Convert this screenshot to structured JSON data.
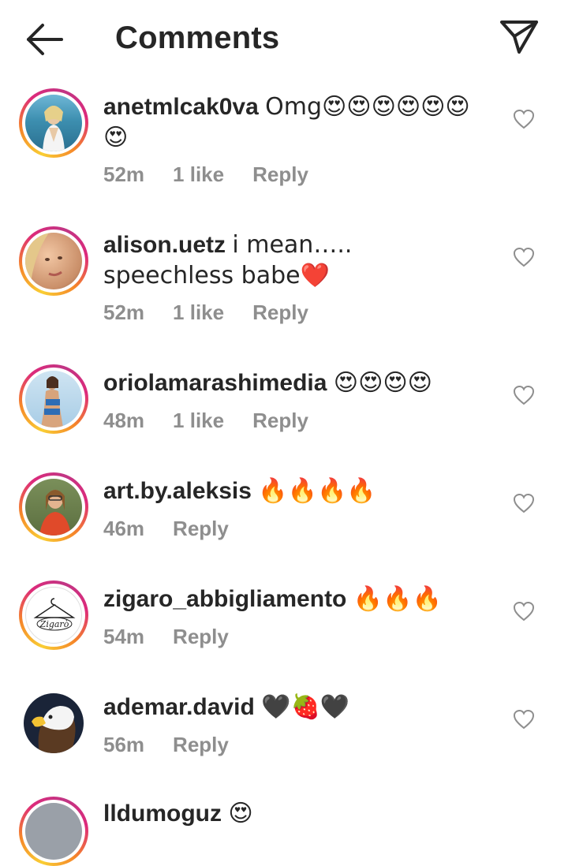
{
  "header": {
    "title": "Comments",
    "back_icon": "arrow-left-icon",
    "send_icon": "paper-plane-icon"
  },
  "colors": {
    "text": "#262626",
    "meta": "#8e8e8e",
    "ring_start": "#f9ce34",
    "ring_mid": "#dd2a7b",
    "ring_end": "#c13584"
  },
  "comments": [
    {
      "username": "anetmlcak0va",
      "text": "Omg😍😍😍😍😍😍😍",
      "time": "52m",
      "likes": "1 like",
      "reply": "Reply"
    },
    {
      "username": "alison.uetz",
      "text": "i mean….. speechless babe❤️",
      "time": "52m",
      "likes": "1 like",
      "reply": "Reply"
    },
    {
      "username": "oriolamarashimedia",
      "text": "😍😍😍😍",
      "time": "48m",
      "likes": "1 like",
      "reply": "Reply"
    },
    {
      "username": "art.by.aleksis",
      "text": "🔥🔥🔥🔥",
      "time": "46m",
      "reply": "Reply"
    },
    {
      "username": "zigaro_abbigliamento",
      "text": "🔥🔥🔥",
      "time": "54m",
      "reply": "Reply"
    },
    {
      "username": "ademar.david",
      "text": "🖤🍓🖤",
      "time": "56m",
      "reply": "Reply"
    }
  ],
  "partial_comment": {
    "username": "lldumoguz",
    "text": "😍"
  }
}
